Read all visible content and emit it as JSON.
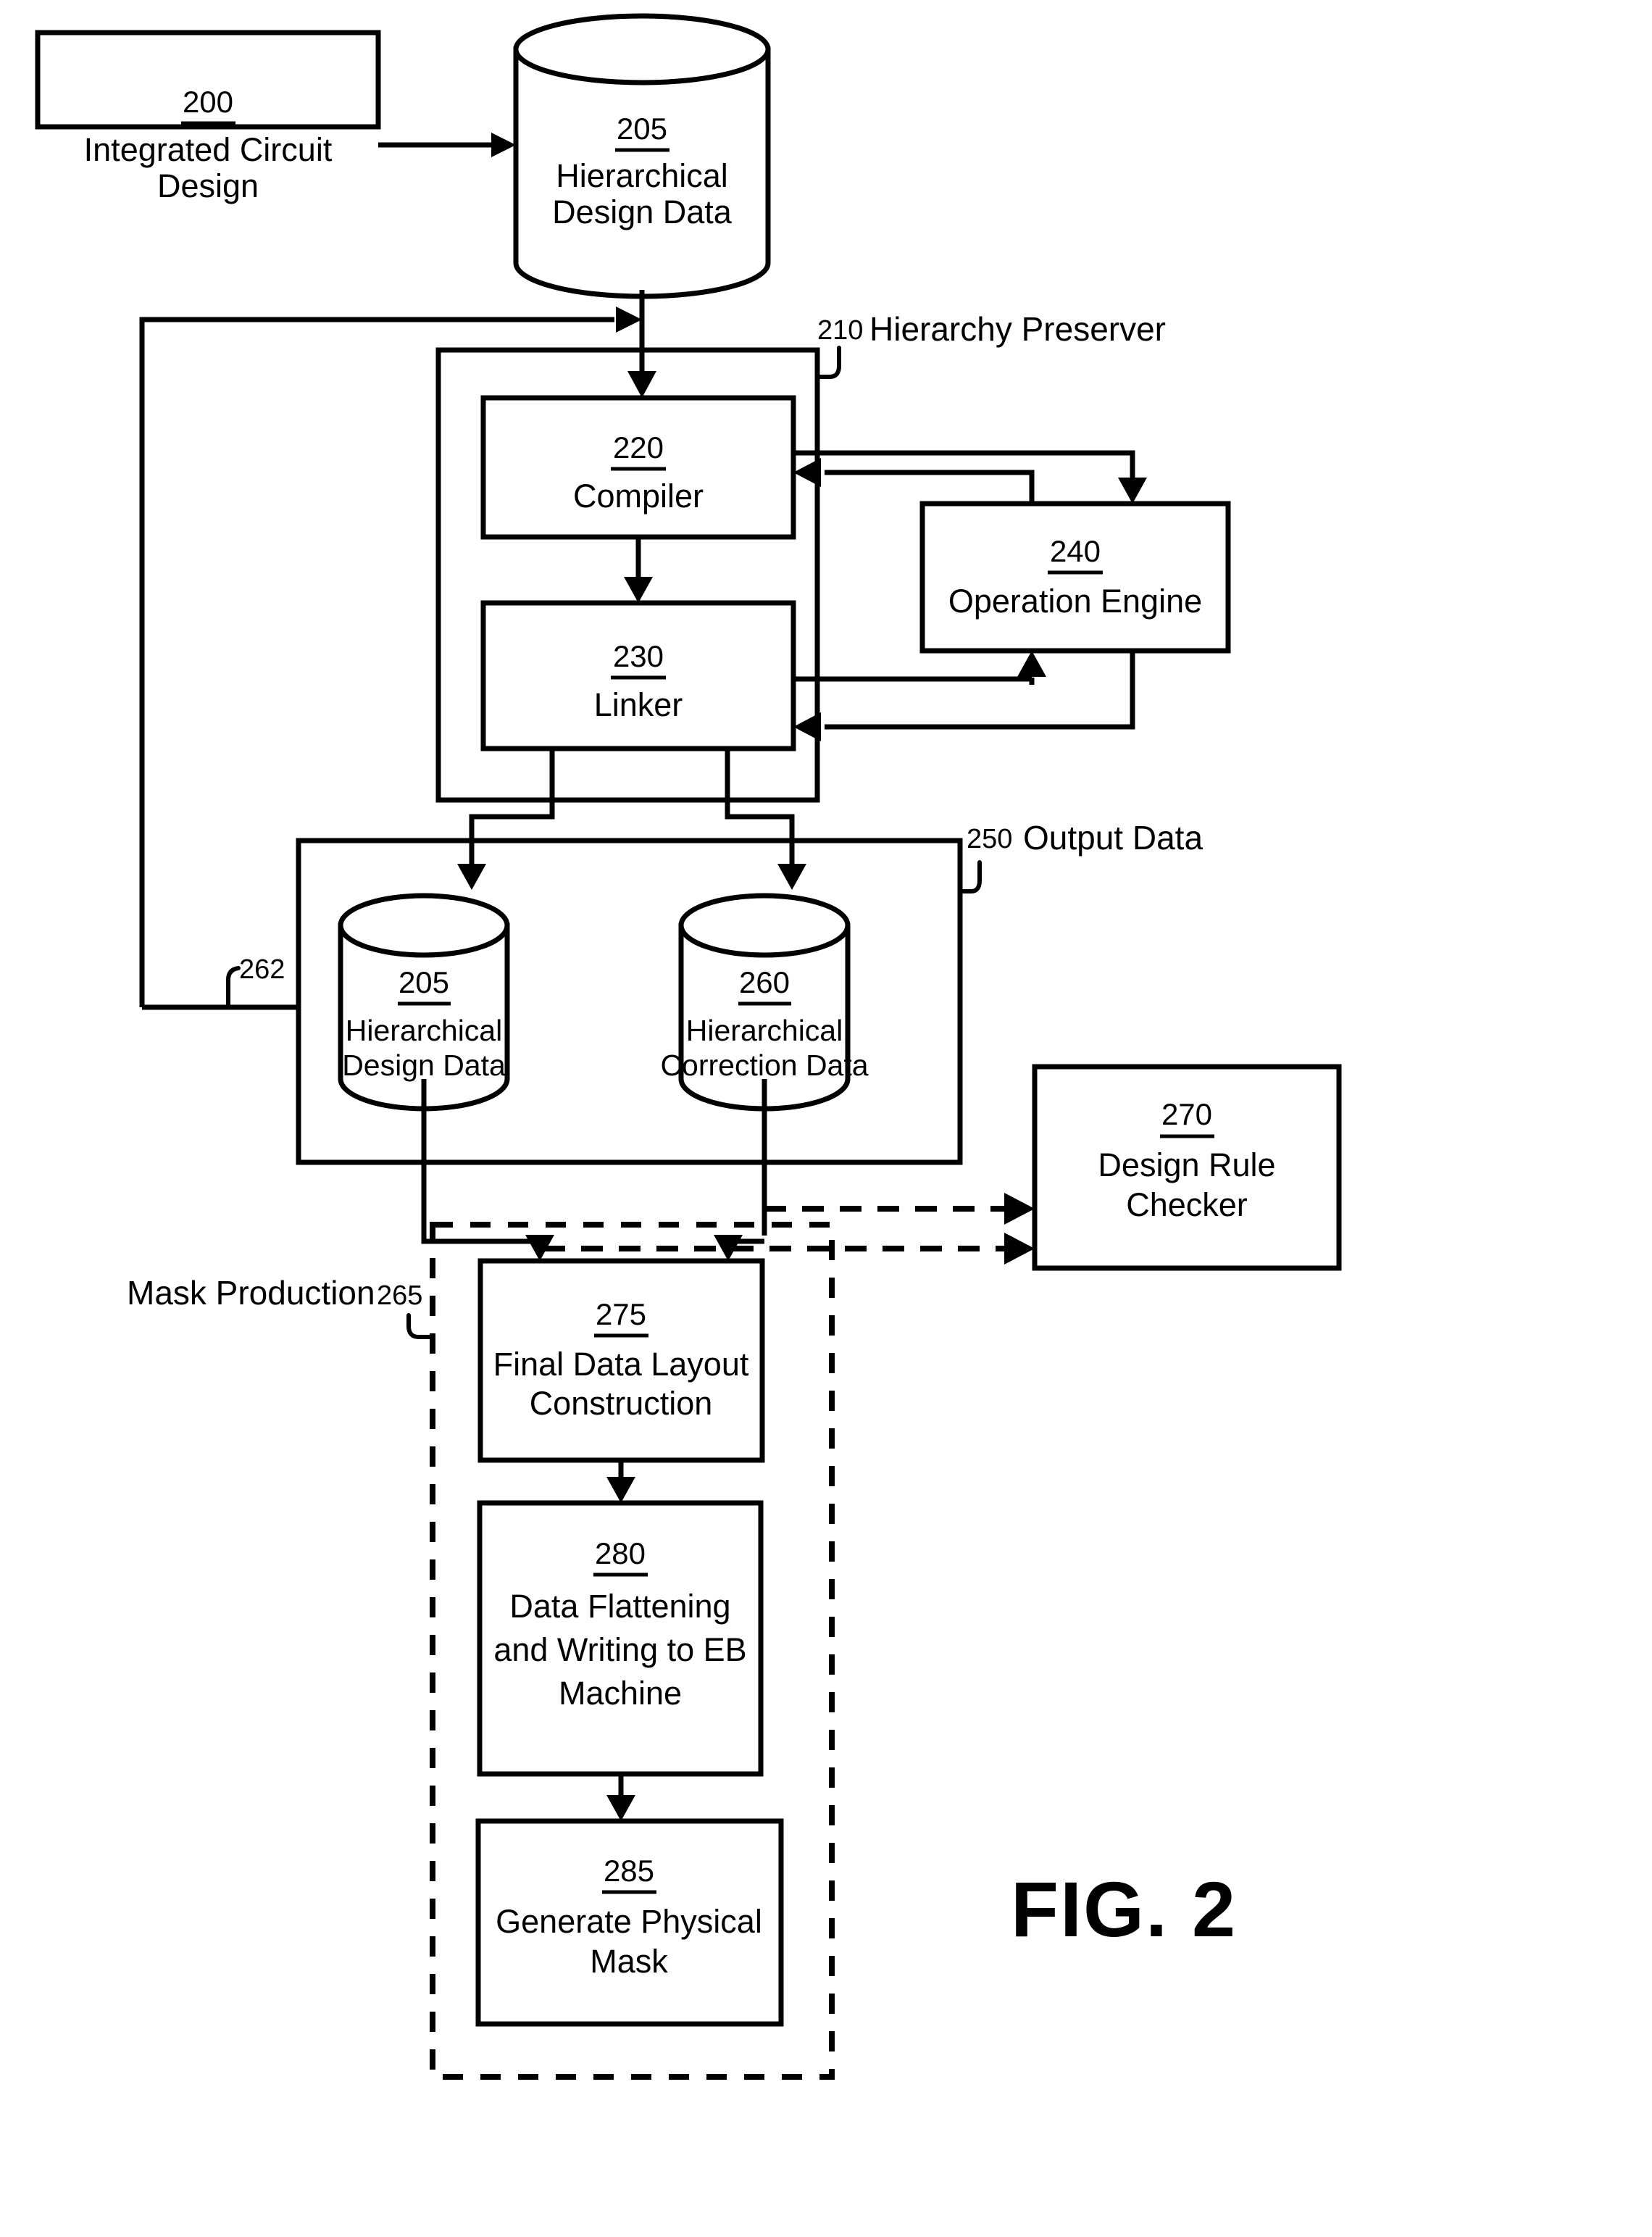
{
  "figure": {
    "title": "FIG. 2",
    "caption_label": "FIG. 2"
  },
  "nodes": {
    "ic_design": {
      "ref": "200",
      "lines": [
        "Integrated Circuit",
        "Design"
      ],
      "shape": "rectangle"
    },
    "hierarchical_design_data_top": {
      "ref": "205",
      "lines": [
        "Hierarchical",
        "Design Data"
      ],
      "shape": "cylinder"
    },
    "hierarchy_preserver": {
      "ref": "210",
      "label": "Hierarchy Preserver",
      "shape": "group-rectangle"
    },
    "compiler": {
      "ref": "220",
      "lines": [
        "Compiler"
      ],
      "shape": "rectangle"
    },
    "linker": {
      "ref": "230",
      "lines": [
        "Linker"
      ],
      "shape": "rectangle"
    },
    "operation_engine": {
      "ref": "240",
      "lines": [
        "Operation Engine"
      ],
      "shape": "rectangle"
    },
    "output_data": {
      "ref": "250",
      "label": "Output Data",
      "shape": "group-rectangle"
    },
    "hierarchical_design_data_out": {
      "ref": "205",
      "lines": [
        "Hierarchical",
        "Design Data"
      ],
      "shape": "cylinder"
    },
    "hierarchical_correction_data": {
      "ref": "260",
      "lines": [
        "Hierarchical",
        "Correction Data"
      ],
      "shape": "cylinder"
    },
    "design_rule_checker": {
      "ref": "270",
      "lines": [
        "Design Rule",
        "Checker"
      ],
      "shape": "rectangle"
    },
    "mask_production": {
      "ref": "265",
      "label": "Mask Production",
      "shape": "dashed-group-rectangle"
    },
    "final_data_layout": {
      "ref": "275",
      "lines": [
        "Final Data Layout",
        "Construction"
      ],
      "shape": "rectangle"
    },
    "data_flattening": {
      "ref": "280",
      "lines": [
        "Data Flattening",
        "and Writing to EB",
        "Machine"
      ],
      "shape": "rectangle"
    },
    "generate_physical_mask": {
      "ref": "285",
      "lines": [
        "Generate Physical",
        "Mask"
      ],
      "shape": "rectangle"
    },
    "feedback_path": {
      "ref": "262"
    }
  },
  "colors": {
    "ink": "#000000",
    "paper": "#ffffff"
  }
}
